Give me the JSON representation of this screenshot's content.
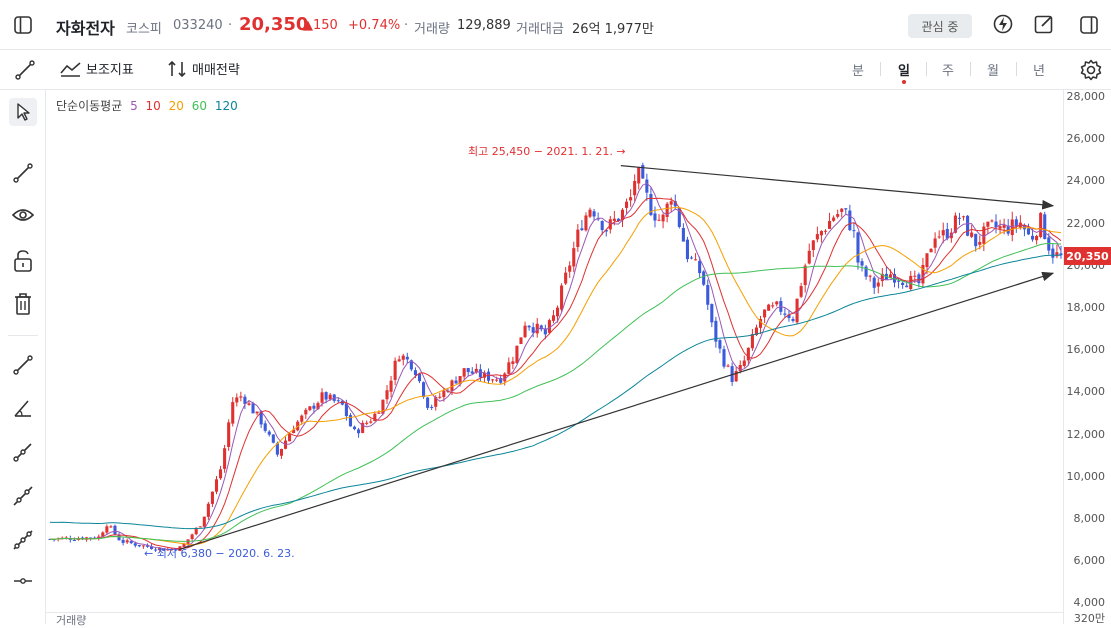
{
  "header": {
    "stock_name": "자화전자",
    "market": "코스피",
    "code": "033240",
    "price": "20,350",
    "change": "▲150",
    "change_pct": "+0.74%",
    "volume_label": "거래량",
    "volume_value": "129,889",
    "amount_label": "거래대금",
    "amount_value": "26억 1,977만",
    "watch_button": "관심 중"
  },
  "toolbar": {
    "indicator_label": "보조지표",
    "strategy_label": "매매전략",
    "periods": [
      "분",
      "일",
      "주",
      "월",
      "년"
    ],
    "active_period": "일"
  },
  "ma_legend": {
    "title": "단순이동평균",
    "items": [
      {
        "label": "5",
        "color": "#9b59b6"
      },
      {
        "label": "10",
        "color": "#e03131"
      },
      {
        "label": "20",
        "color": "#f59f00"
      },
      {
        "label": "60",
        "color": "#40c057"
      },
      {
        "label": "120",
        "color": "#0c8599"
      }
    ]
  },
  "annotations": {
    "high": "최고 25,450 − 2021. 1. 21. →",
    "low": "← 최저 6,380 − 2020. 6. 23."
  },
  "price_tag": "20,350",
  "volume_legend": "거래량",
  "colors": {
    "up": "#e03131",
    "down": "#3b5bdb"
  },
  "chart_data": {
    "type": "candlestick",
    "y_ticks": [
      "28,000",
      "26,000",
      "24,000",
      "22,000",
      "20,000",
      "18,000",
      "16,000",
      "14,000",
      "12,000",
      "10,000",
      "8,000",
      "6,000",
      "4,000",
      "320만"
    ],
    "ylim": [
      4000,
      28000
    ],
    "high": 25450,
    "low": 6380,
    "current": 20350,
    "trend_lines": [
      {
        "from": [
          0.13,
          6500
        ],
        "to": [
          1.0,
          19600
        ],
        "name": "support"
      },
      {
        "from": [
          0.57,
          24700
        ],
        "to": [
          1.0,
          22800
        ],
        "name": "resistance"
      }
    ]
  }
}
